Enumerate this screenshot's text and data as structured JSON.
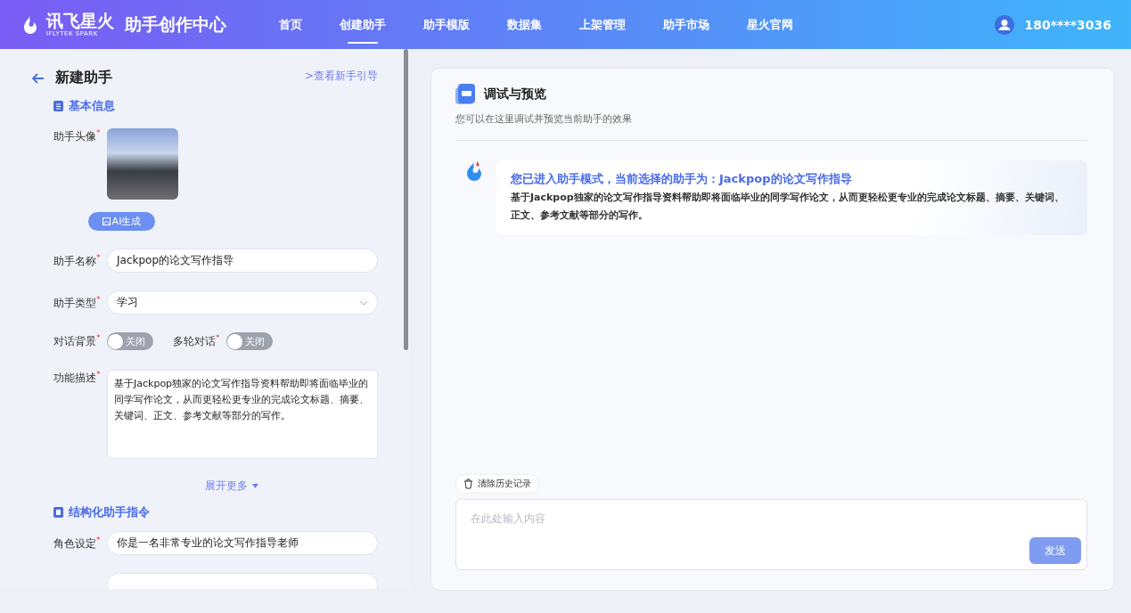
{
  "header": {
    "logo_text": "讯飞星火",
    "logo_subtext": "IFLYTEK SPARK",
    "product_title": "助手创作中心",
    "nav": [
      {
        "label": "首页",
        "selected": false
      },
      {
        "label": "创建助手",
        "selected": true
      },
      {
        "label": "助手模版",
        "selected": false
      },
      {
        "label": "数据集",
        "selected": false
      },
      {
        "label": "上架管理",
        "selected": false
      },
      {
        "label": "助手市场",
        "selected": false
      },
      {
        "label": "星火官网",
        "selected": false
      }
    ],
    "user": "180****3036"
  },
  "form": {
    "title": "新建助手",
    "guide_link": ">查看新手引导",
    "section_basic": "基本信息",
    "avatar_label": "助手头像$^{*}$",
    "ai_button": "AI生成",
    "name_label": "助手名称$^{*}$",
    "name_value": "Jackpop的论文写作指导",
    "type_label": "助手类型$^{*}$",
    "type_value": "学习",
    "toggles": [
      {
        "label": "对话背景$^{*}$",
        "state_text": "关闭",
        "on": false
      },
      {
        "label": "多轮对话$^{*}$",
        "state_text": "关闭",
        "on": false
      }
    ],
    "desc_label": "功能描述$^{*}$",
    "desc_value": "基于Jackpop独家的论文写作指导资料帮助即将面临毕业的同学写作论文，从而更轻松更专业的完成论文标题、摘要、关键词、正文、参考文献等部分的写作。",
    "expand_more": "展开更多",
    "section_prompt": "结构化助手指令",
    "role_label": "角色设定$^{*}$",
    "role_value": "你是一名非常专业的论文写作指导老师"
  },
  "preview": {
    "title": "调试与预览",
    "subtitle": "您可以在这里调试并预览当前助手的效果",
    "message": {
      "heading": "您已进入助手模式，当前选择的助手为：Jackpop的论文写作指导",
      "body": "基于Jackpop独家的论文写作指导资料帮助即将面临毕业的同学写作论文，从而更轻松更专业的完成论文标题、摘要、关键词、正文、参考文献等部分的写作。"
    },
    "clear_history": "清除历史记录",
    "input_placeholder": "在此处输入内容",
    "send": "发送"
  }
}
